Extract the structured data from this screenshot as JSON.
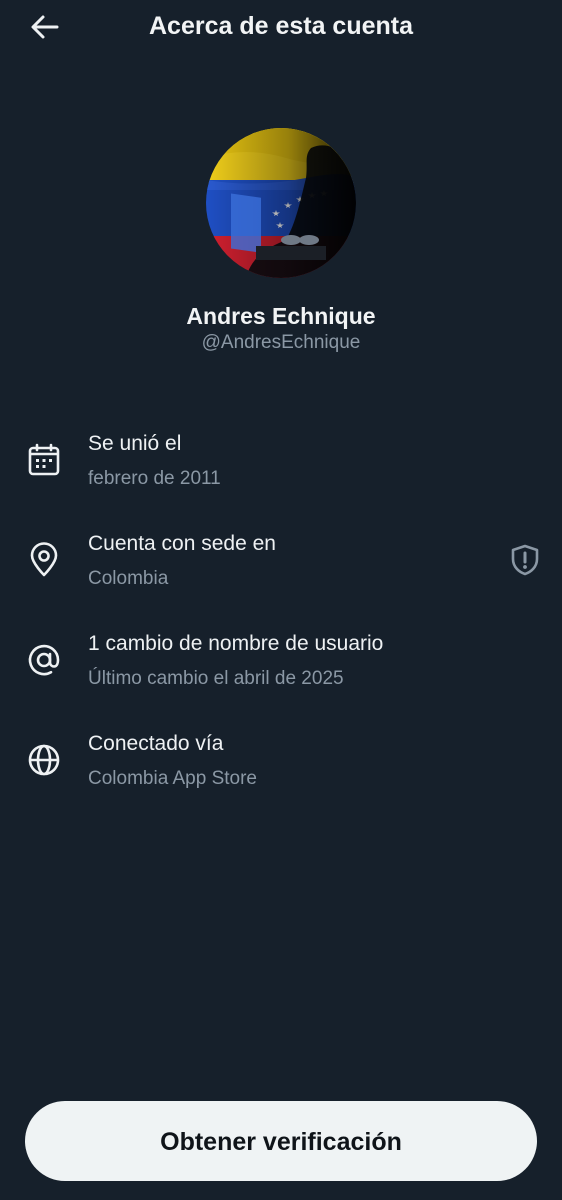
{
  "header": {
    "title": "Acerca de esta cuenta",
    "back_icon": "arrow-left-icon"
  },
  "profile": {
    "name": "Andres Echnique",
    "handle": "@AndresEchnique",
    "avatar_description": "venezuelan-flag-avatar"
  },
  "items": [
    {
      "icon": "calendar-icon",
      "title": "Se unió el",
      "subtitle": "febrero de 2011"
    },
    {
      "icon": "location-pin-icon",
      "title": "Cuenta con sede en",
      "subtitle": "Colombia",
      "trailing_icon": "shield-alert-icon"
    },
    {
      "icon": "at-sign-icon",
      "title": "1 cambio de nombre de usuario",
      "subtitle": "Último cambio el abril de 2025"
    },
    {
      "icon": "globe-icon",
      "title": "Conectado vía",
      "subtitle": "Colombia App Store"
    }
  ],
  "cta": {
    "label": "Obtener verificación"
  },
  "colors": {
    "background": "#16202b",
    "primary_text": "#e7e9ea",
    "secondary_text": "#8b98a5",
    "button_bg": "#eff3f4",
    "button_text": "#0f1419"
  }
}
